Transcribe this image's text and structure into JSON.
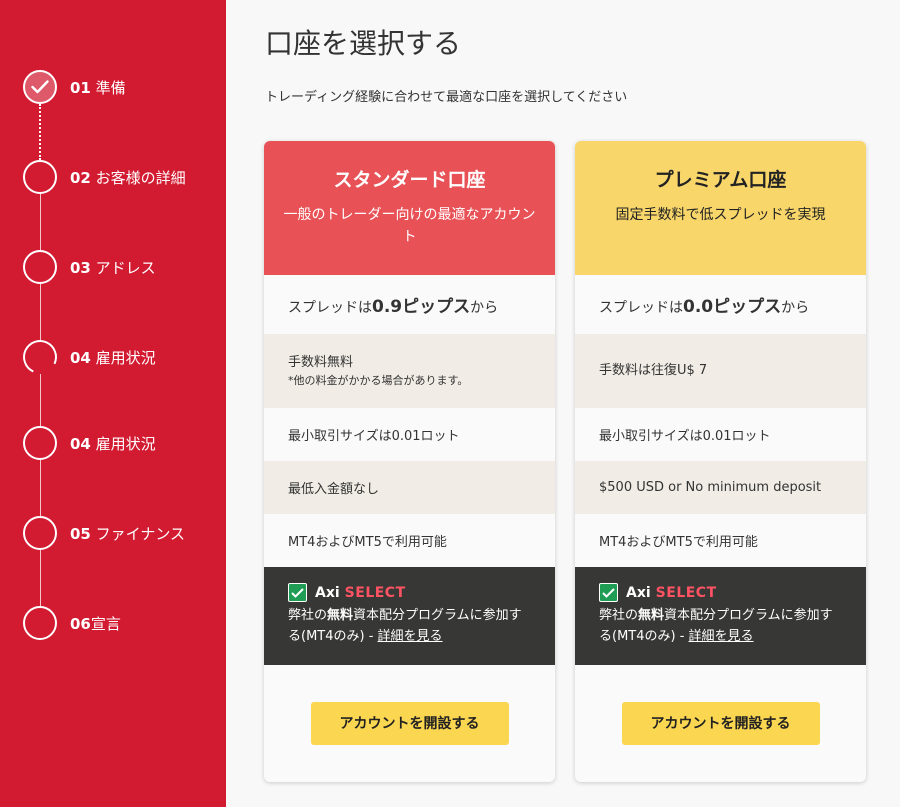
{
  "page": {
    "title": "口座を選択する",
    "subtitle": "トレーディング経験に合わせて最適な口座を選択してください"
  },
  "steps": [
    {
      "num": "01",
      "label": "準備",
      "icon": "check-icon"
    },
    {
      "num": "02",
      "label": "お客様の詳細"
    },
    {
      "num": "03",
      "label": "アドレス"
    },
    {
      "num": "04",
      "label": "雇用状況"
    },
    {
      "num": "04",
      "label": "雇用状況"
    },
    {
      "num": "05",
      "label": "ファイナンス"
    },
    {
      "num": "06",
      "label": "宣言"
    }
  ],
  "accounts": {
    "standard": {
      "name": "スタンダード口座",
      "desc": "一般のトレーダー向けの最適なアカウント",
      "spread_pre": "スプレッドは",
      "spread_value": "0.9ピップス",
      "spread_post": "から",
      "commission": "手数料無料",
      "commission_note": "*他の料金がかかる場合があります。",
      "min_lot": "最小取引サイズは0.01ロット",
      "min_deposit": "最低入金額なし",
      "platforms": "MT4およびMT5で利用可能",
      "select_brand": "Axi",
      "select_word": "SELECT",
      "select_text_1": "弊社の",
      "select_text_bold": "無料",
      "select_text_2": "資本配分プログラムに参加する(MT4のみ) - ",
      "select_link": "詳細を見る",
      "button": "アカウントを開設する",
      "color": "#e85257"
    },
    "premium": {
      "name": "プレミアム口座",
      "desc": "固定手数料で低スプレッドを実現",
      "spread_pre": "スプレッドは",
      "spread_value": "0.0ピップス",
      "spread_post": "から",
      "commission": "手数料は往復U$ 7",
      "min_lot": "最小取引サイズは0.01ロット",
      "min_deposit": "$500 USD or No minimum deposit",
      "platforms": "MT4およびMT5で利用可能",
      "select_brand": "Axi",
      "select_word": "SELECT",
      "select_text_1": "弊社の",
      "select_text_bold": "無料",
      "select_text_2": "資本配分プログラムに参加する(MT4のみ) - ",
      "select_link": "詳細を見る",
      "button": "アカウントを開設する",
      "color": "#f8d66a"
    }
  },
  "colors": {
    "sidebar": "#d21a31",
    "button": "#fbd650",
    "select_bg": "#373735",
    "select_accent": "#ff5364"
  }
}
